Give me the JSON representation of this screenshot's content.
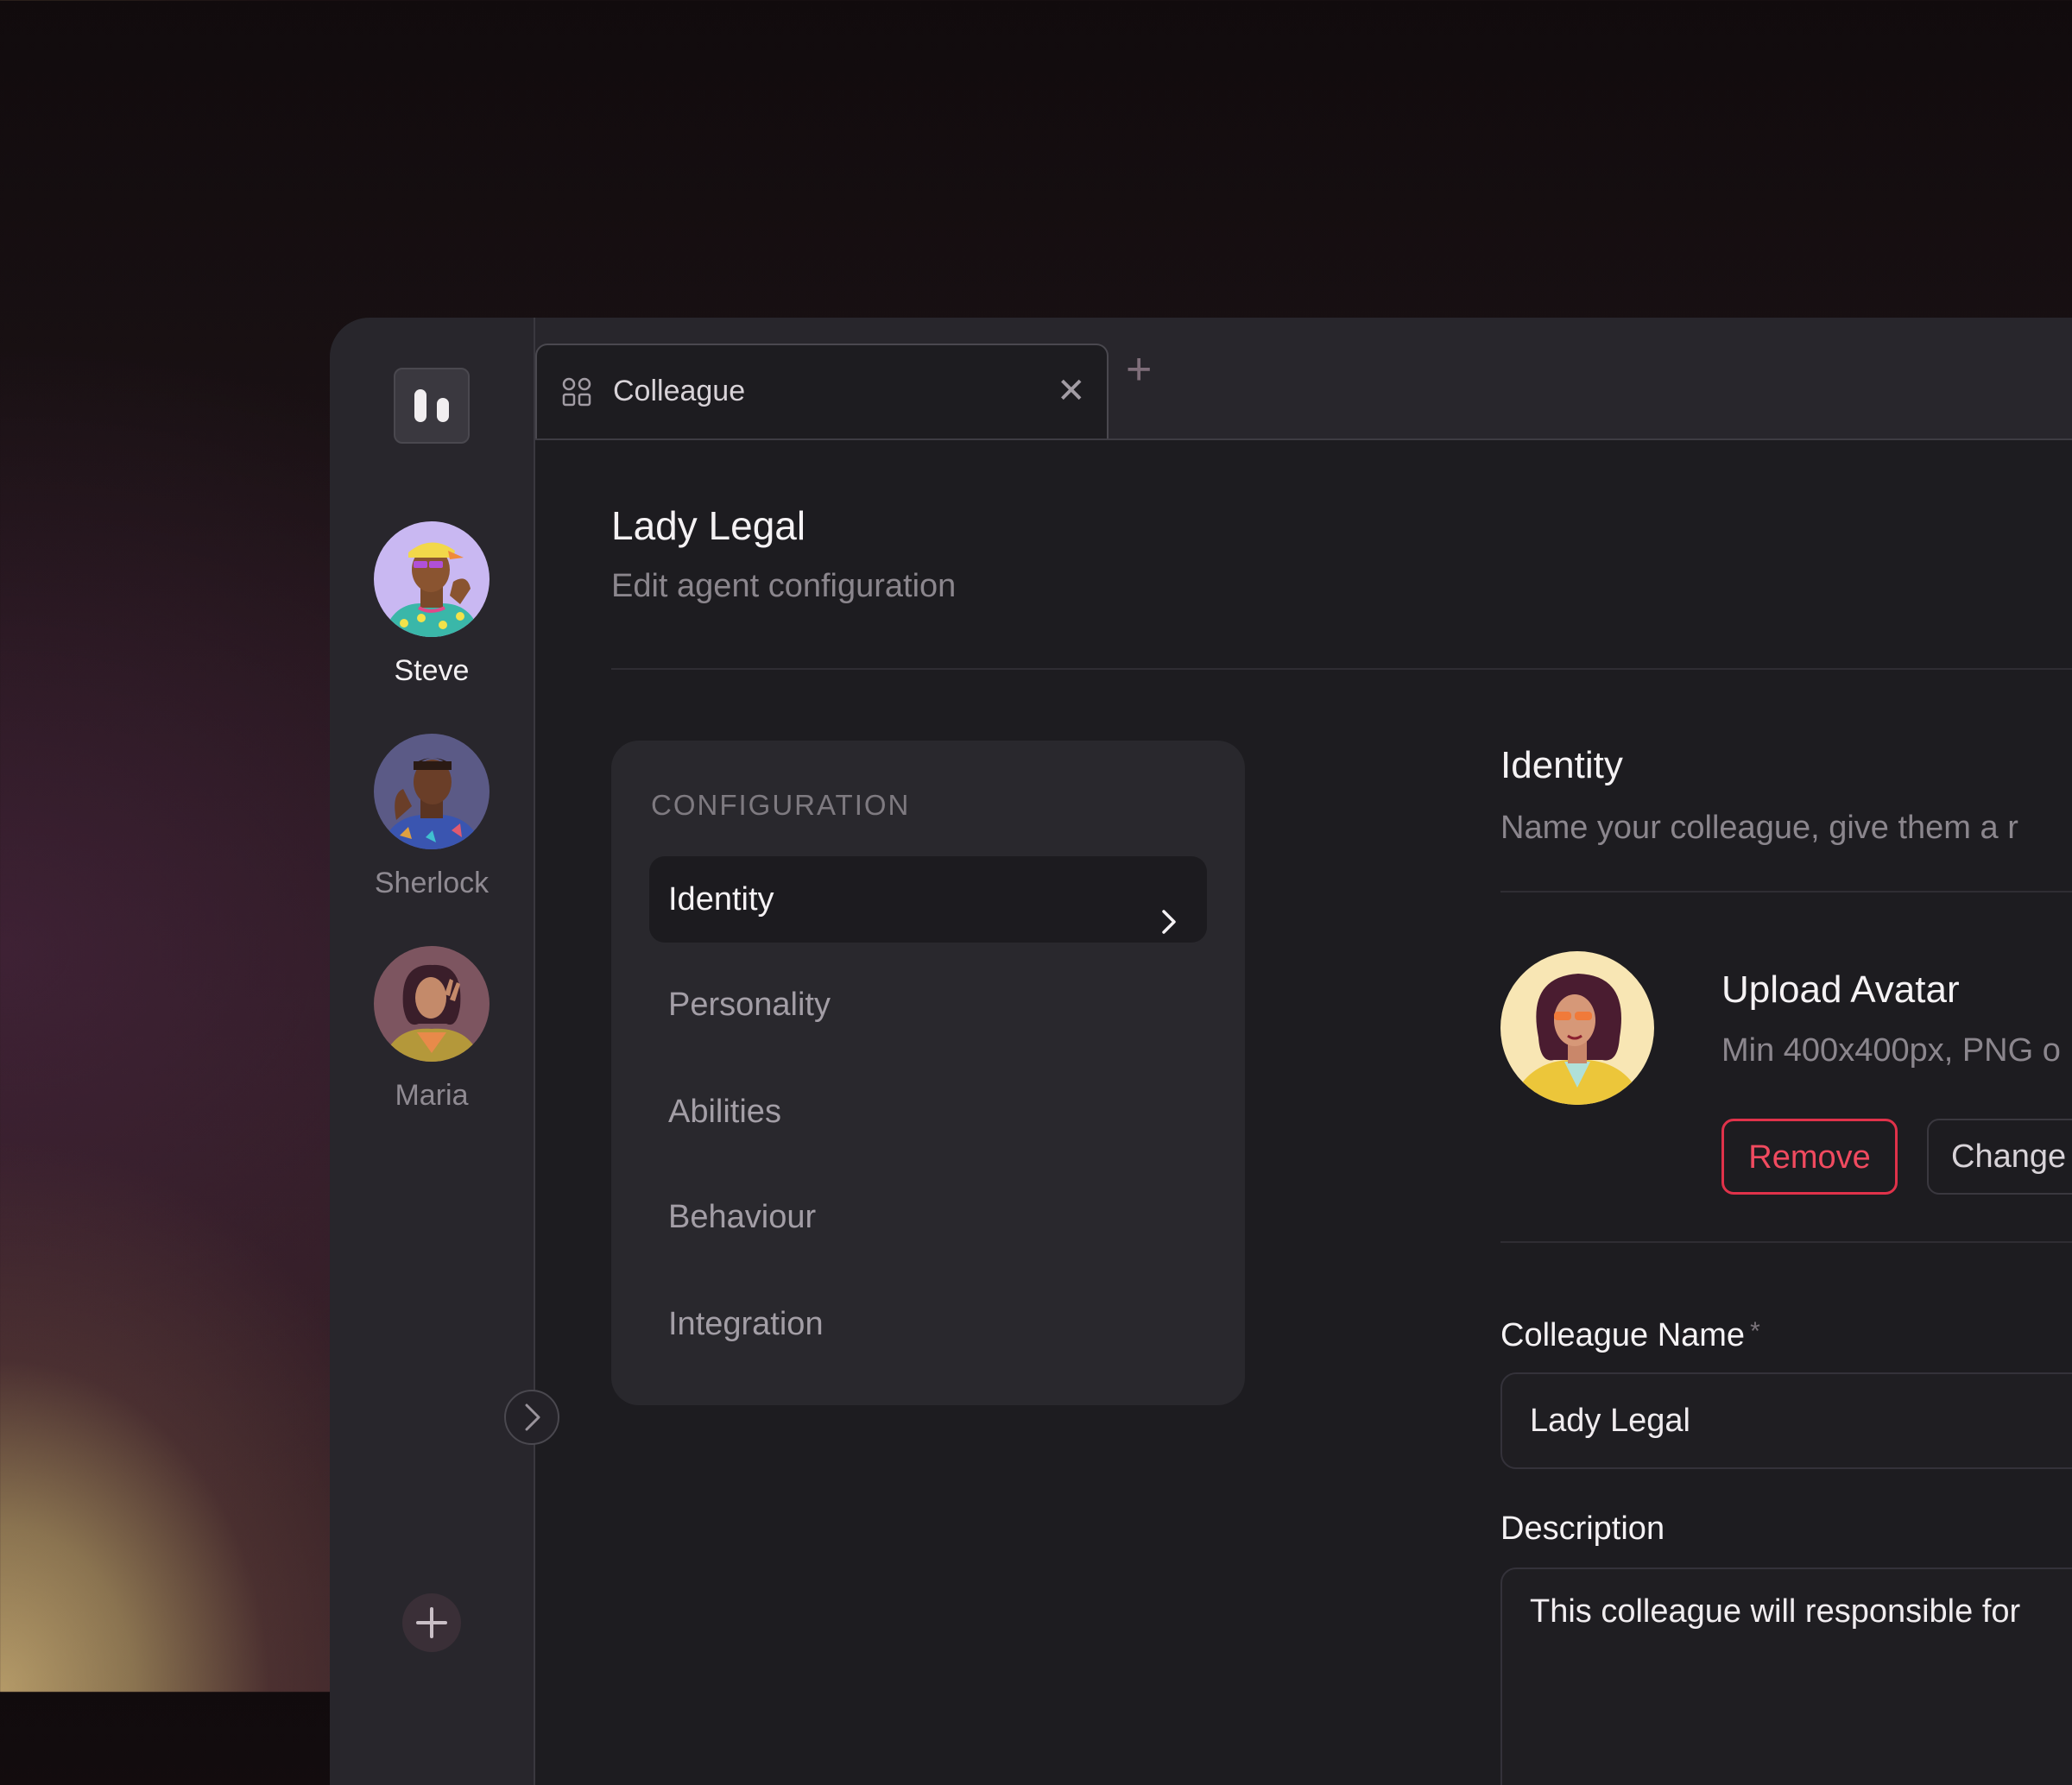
{
  "sidebar": {
    "agents": [
      {
        "name": "Steve",
        "active": true
      },
      {
        "name": "Sherlock",
        "active": false
      },
      {
        "name": "Maria",
        "active": false
      }
    ],
    "add_icon": "plus-icon",
    "collapse_icon": "chevron-right-icon"
  },
  "tab": {
    "title": "Colleague",
    "icon": "grid-icon",
    "close_glyph": "✕",
    "add_glyph": "+"
  },
  "page": {
    "title": "Lady Legal",
    "subtitle": "Edit agent configuration"
  },
  "config": {
    "heading": "CONFIGURATION",
    "items": [
      "Identity",
      "Personality",
      "Abilities",
      "Behaviour",
      "Integration"
    ],
    "active_item": "Identity"
  },
  "identity": {
    "title": "Identity",
    "description": "Name your colleague, give them a r",
    "upload_title": "Upload Avatar",
    "upload_hint": "Min 400x400px, PNG o",
    "remove_label": "Remove",
    "change_label": "Change",
    "name_label": "Colleague Name",
    "name_required": "*",
    "name_value": "Lady Legal",
    "description_label": "Description",
    "description_value": "This colleague will responsible for"
  },
  "colors": {
    "accent_danger": "#e0324a",
    "background": "#1d1c20",
    "sidebar": "#28262c"
  }
}
